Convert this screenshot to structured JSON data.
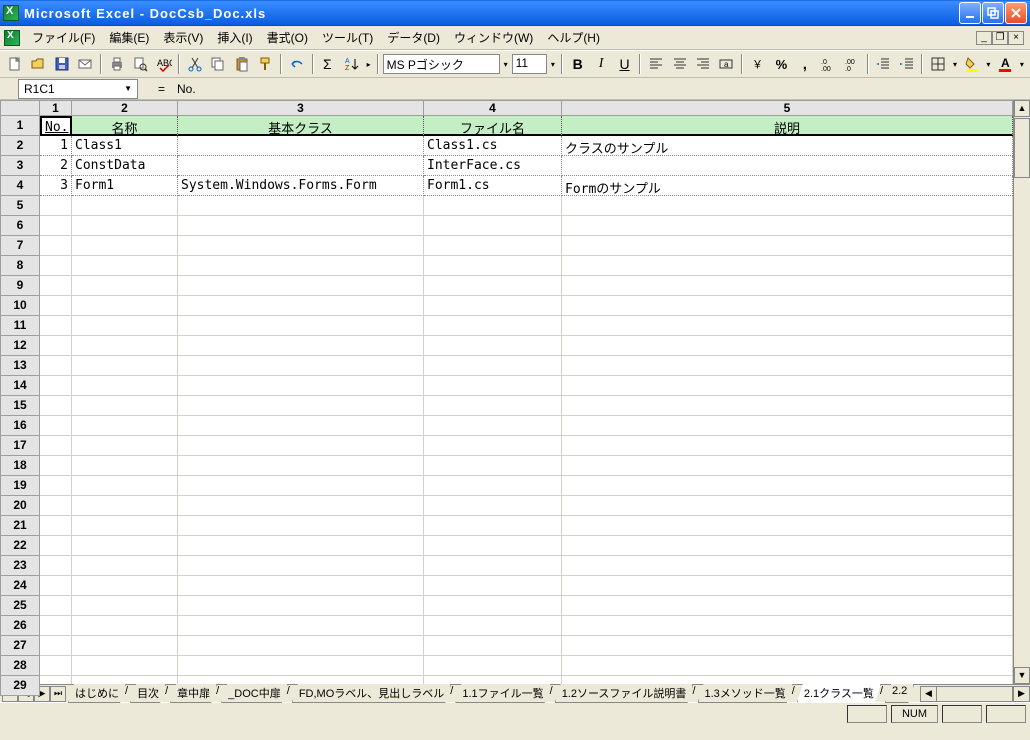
{
  "title": "Microsoft Excel - DocCsb_Doc.xls",
  "menu": [
    "ファイル(F)",
    "編集(E)",
    "表示(V)",
    "挿入(I)",
    "書式(O)",
    "ツール(T)",
    "データ(D)",
    "ウィンドウ(W)",
    "ヘルプ(H)"
  ],
  "namebox": "R1C1",
  "formula": "No.",
  "font": {
    "name": "MS Pゴシック",
    "size": "11"
  },
  "col_headers": [
    "1",
    "2",
    "3",
    "4",
    "5"
  ],
  "row_headers": [
    "1",
    "2",
    "3",
    "4",
    "5",
    "6",
    "7",
    "8",
    "9",
    "10",
    "11",
    "12",
    "13",
    "14",
    "15",
    "16",
    "17",
    "18",
    "19",
    "20",
    "21",
    "22",
    "23",
    "24",
    "25",
    "26",
    "27",
    "28",
    "29"
  ],
  "headers": [
    "No.",
    "名称",
    "基本クラス",
    "ファイル名",
    "説明"
  ],
  "rows": [
    {
      "no": "1",
      "name": "Class1",
      "base": "",
      "file": "Class1.cs",
      "desc": "クラスのサンプル"
    },
    {
      "no": "2",
      "name": "ConstData",
      "base": "",
      "file": "InterFace.cs",
      "desc": ""
    },
    {
      "no": "3",
      "name": "Form1",
      "base": "System.Windows.Forms.Form",
      "file": "Form1.cs",
      "desc": "Formのサンプル"
    }
  ],
  "sheets": [
    "はじめに",
    "目次",
    "章中扉",
    "_DOC中扉",
    "FD,MOラベル、見出しラベル",
    "1.1ファイル一覧",
    "1.2ソースファイル説明書",
    "1.3メソッド一覧",
    "2.1クラス一覧",
    "2.2"
  ],
  "active_sheet": "2.1クラス一覧",
  "status": {
    "num": "NUM"
  }
}
